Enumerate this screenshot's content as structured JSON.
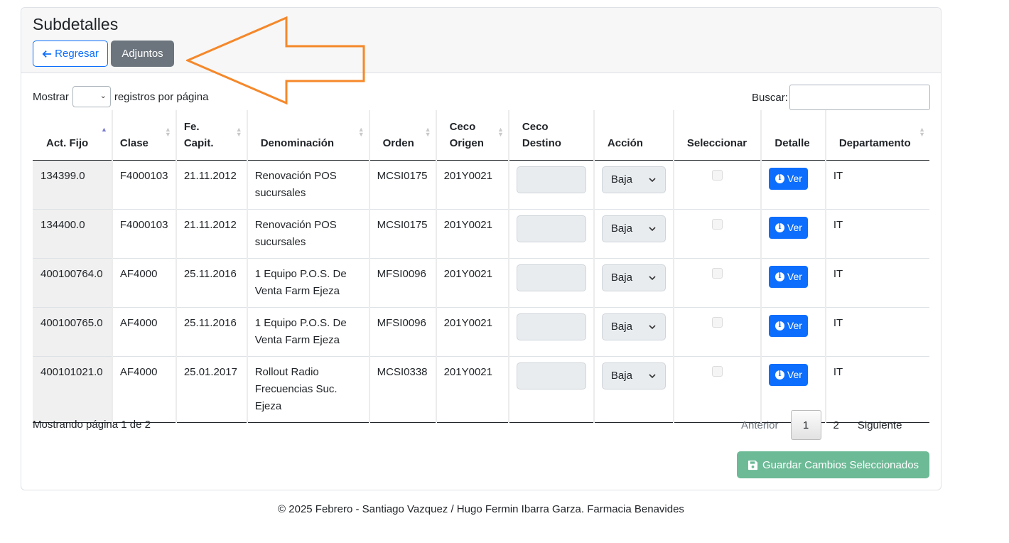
{
  "header": {
    "title": "Subdetalles",
    "back_label": "Regresar",
    "attachments_label": "Adjuntos"
  },
  "controls": {
    "show_label": "Mostrar",
    "per_page_label": "registros por página",
    "search_label": "Buscar:"
  },
  "table": {
    "columns": [
      "Act. Fijo",
      "Clase",
      "Fe. Capit.",
      "Denominación",
      "Orden",
      "Ceco Origen",
      "Ceco Destino",
      "Acción",
      "Seleccionar",
      "Detalle",
      "Departamento"
    ],
    "rows": [
      {
        "act": "134399.0",
        "clase": "F4000103",
        "fecha": "21.11.2012",
        "denominacion": "Renovación POS sucursales",
        "orden": "MCSI0175",
        "ceco_origen": "201Y0021",
        "accion": "Baja",
        "detalle": "Ver",
        "departamento": "IT"
      },
      {
        "act": "134400.0",
        "clase": "F4000103",
        "fecha": "21.11.2012",
        "denominacion": "Renovación POS sucursales",
        "orden": "MCSI0175",
        "ceco_origen": "201Y0021",
        "accion": "Baja",
        "detalle": "Ver",
        "departamento": "IT"
      },
      {
        "act": "400100764.0",
        "clase": "AF4000",
        "fecha": "25.11.2016",
        "denominacion": "1 Equipo P.O.S. De Venta Farm Ejeza",
        "orden": "MFSI0096",
        "ceco_origen": "201Y0021",
        "accion": "Baja",
        "detalle": "Ver",
        "departamento": "IT"
      },
      {
        "act": "400100765.0",
        "clase": "AF4000",
        "fecha": "25.11.2016",
        "denominacion": "1 Equipo P.O.S. De Venta Farm Ejeza",
        "orden": "MFSI0096",
        "ceco_origen": "201Y0021",
        "accion": "Baja",
        "detalle": "Ver",
        "departamento": "IT"
      },
      {
        "act": "400101021.0",
        "clase": "AF4000",
        "fecha": "25.01.2017",
        "denominacion": "Rollout Radio Frecuencias Suc. Ejeza",
        "orden": "MCSI0338",
        "ceco_origen": "201Y0021",
        "accion": "Baja",
        "detalle": "Ver",
        "departamento": "IT"
      }
    ]
  },
  "pagination": {
    "info": "Mostrando página 1 de 2",
    "prev": "Anterior",
    "current": "1",
    "page2": "2",
    "next": "Siguiente"
  },
  "save_label": "Guardar Cambios Seleccionados",
  "footer": "© 2025 Febrero - Santiago Vazquez / Hugo Fermin Ibarra Garza. Farmacia Benavides",
  "colors": {
    "primary": "#0d6efd",
    "secondary": "#6c757d",
    "success_disabled": "#6cba96",
    "annotation_arrow": "#f5882a"
  }
}
